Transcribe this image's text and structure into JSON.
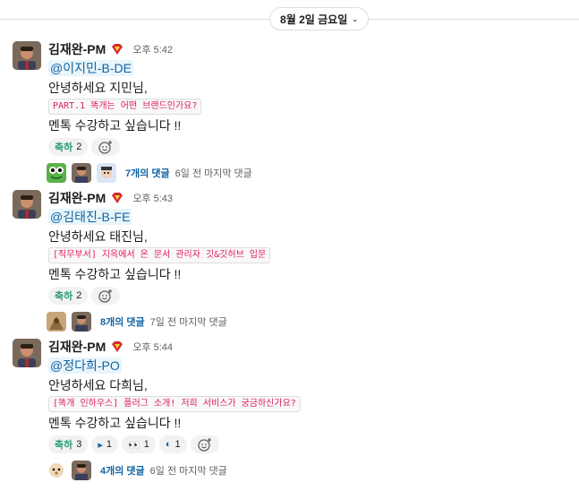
{
  "date_divider": {
    "label": "8월 2일 금요일"
  },
  "messages": [
    {
      "author": "김재완-PM",
      "time": "오후 5:42",
      "mention": "@이지민-B-DE",
      "greeting": "안녕하세요 지민님,",
      "code": "PART.1 똑개는 어떤 브랜드인가요?",
      "body": "멘톡 수강하고 싶습니다 !!",
      "reactions": [
        {
          "emoji": "축하",
          "count": "2"
        }
      ],
      "thread": {
        "count": "7개의 댓글",
        "last": "6일 전 마지막 댓글"
      }
    },
    {
      "author": "김재완-PM",
      "time": "오후 5:43",
      "mention": "@김태진-B-FE",
      "greeting": "안녕하세요 태진님,",
      "code": "[직무부서] 지옥에서 온 문서 관리자 깃&깃허브 입문",
      "body": "멘톡 수강하고 싶습니다 !!",
      "reactions": [
        {
          "emoji": "축하",
          "count": "2"
        }
      ],
      "thread": {
        "count": "8개의 댓글",
        "last": "7일 전 마지막 댓글"
      }
    },
    {
      "author": "김재완-PM",
      "time": "오후 5:44",
      "mention": "@정다희-PO",
      "greeting": "안녕하세요 다희님,",
      "code": "[똑개 인하우스] 플러그 소개! 저희 서비스가 궁금하신가요?",
      "body": "멘톡 수강하고 싶습니다 !!",
      "reactions": [
        {
          "emoji": "축하",
          "count": "3"
        },
        {
          "emoji": "▸",
          "count": "1"
        },
        {
          "emoji": "👀",
          "count": "1"
        },
        {
          "emoji": "◐",
          "count": "1"
        }
      ],
      "thread": {
        "count": "4개의 댓글",
        "last": "6일 전 마지막 댓글"
      }
    }
  ]
}
